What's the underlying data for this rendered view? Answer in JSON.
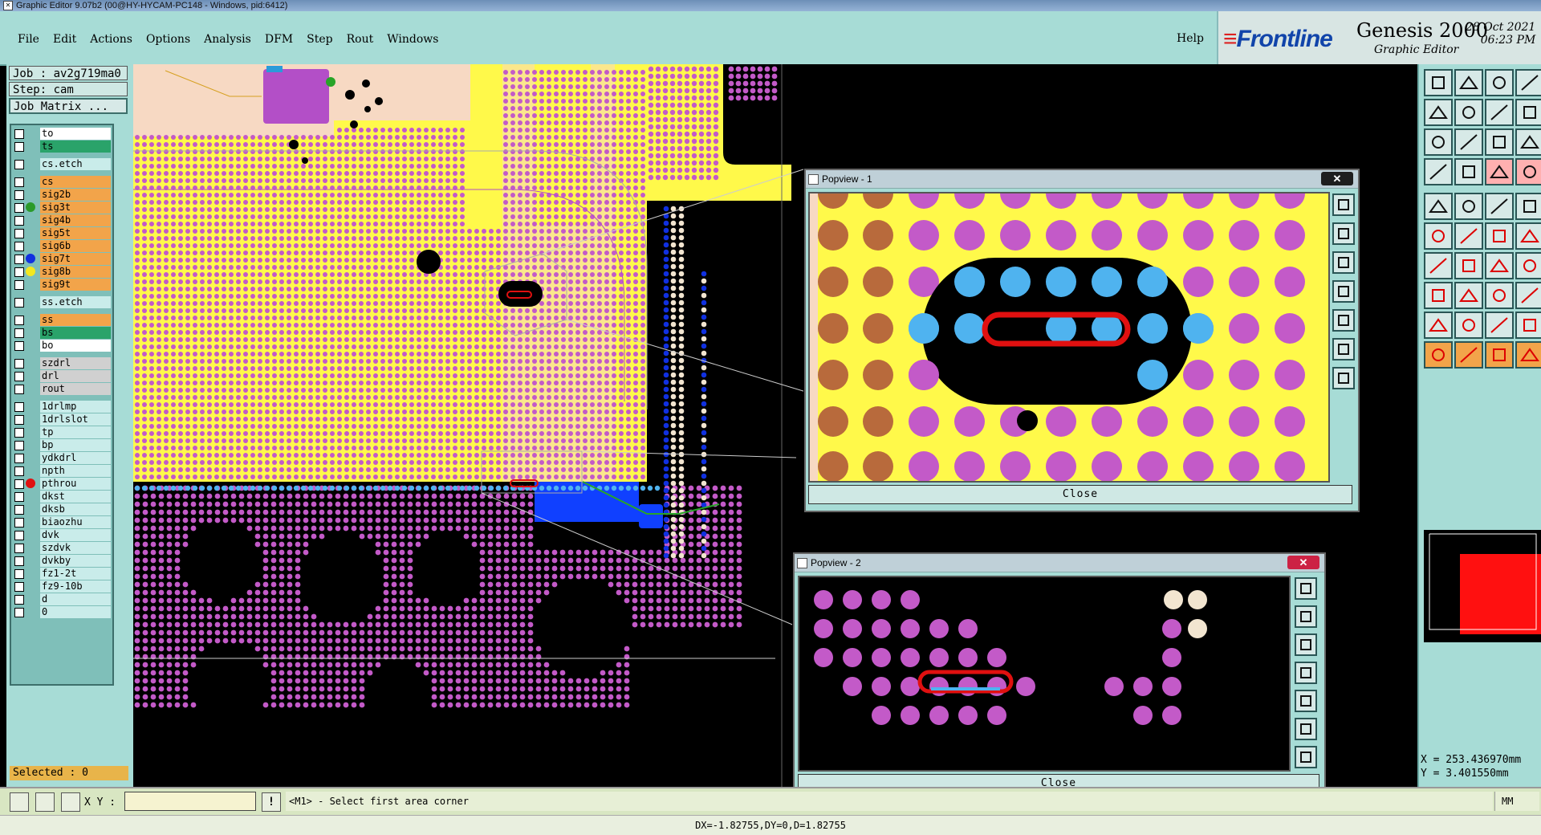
{
  "window": {
    "title": "Graphic Editor 9.07b2 (00@HY-HYCAM-PC148 - Windows, pid:6412)"
  },
  "menu": {
    "items": [
      "File",
      "Edit",
      "Actions",
      "Options",
      "Analysis",
      "DFM",
      "Step",
      "Rout",
      "Windows"
    ],
    "help": "Help"
  },
  "brand": {
    "logo": "Frontline",
    "product": "Genesis 2000",
    "subtitle": "Graphic Editor",
    "date": "28 Oct 2021",
    "time": "06:23 PM"
  },
  "job": {
    "job_label": "Job : av2g719ma0",
    "step_label": "Step: cam",
    "matrix_button": "Job Matrix ..."
  },
  "layers": [
    {
      "name": "to",
      "color": "#ffffff",
      "dot": ""
    },
    {
      "name": "ts",
      "color": "#2aa36a",
      "dot": ""
    },
    {
      "name": "cs.etch",
      "color": "#c9ecea",
      "dot": ""
    },
    {
      "name": "cs",
      "color": "#f2a44a",
      "dot": ""
    },
    {
      "name": "sig2b",
      "color": "#f2a44a",
      "dot": ""
    },
    {
      "name": "sig3t",
      "color": "#f2a44a",
      "dot": "#2a9a2a"
    },
    {
      "name": "sig4b",
      "color": "#f2a44a",
      "dot": ""
    },
    {
      "name": "sig5t",
      "color": "#f2a44a",
      "dot": ""
    },
    {
      "name": "sig6b",
      "color": "#f2a44a",
      "dot": ""
    },
    {
      "name": "sig7t",
      "color": "#f2a44a",
      "dot": "#1030e0"
    },
    {
      "name": "sig8b",
      "color": "#f2a44a",
      "dot": "#f3e81f"
    },
    {
      "name": "sig9t",
      "color": "#f2a44a",
      "dot": ""
    },
    {
      "name": "ss.etch",
      "color": "#c9ecea",
      "dot": ""
    },
    {
      "name": "ss",
      "color": "#f2a44a",
      "dot": ""
    },
    {
      "name": "bs",
      "color": "#2aa36a",
      "dot": ""
    },
    {
      "name": "bo",
      "color": "#ffffff",
      "dot": ""
    },
    {
      "name": "szdrl",
      "color": "#d0d0d0",
      "dot": ""
    },
    {
      "name": "drl",
      "color": "#d0d0d0",
      "dot": ""
    },
    {
      "name": "rout",
      "color": "#d0d0d0",
      "dot": ""
    },
    {
      "name": "1drlmp",
      "color": "#c9ecea",
      "dot": ""
    },
    {
      "name": "1drlslot",
      "color": "#c9ecea",
      "dot": ""
    },
    {
      "name": "tp",
      "color": "#c9ecea",
      "dot": ""
    },
    {
      "name": "bp",
      "color": "#c9ecea",
      "dot": ""
    },
    {
      "name": "ydkdrl",
      "color": "#c9ecea",
      "dot": ""
    },
    {
      "name": "npth",
      "color": "#c9ecea",
      "dot": ""
    },
    {
      "name": "pthrou",
      "color": "#c9ecea",
      "dot": "#e01010"
    },
    {
      "name": "dkst",
      "color": "#c9ecea",
      "dot": ""
    },
    {
      "name": "dksb",
      "color": "#c9ecea",
      "dot": ""
    },
    {
      "name": "biaozhu",
      "color": "#c9ecea",
      "dot": ""
    },
    {
      "name": "dvk",
      "color": "#c9ecea",
      "dot": ""
    },
    {
      "name": "szdvk",
      "color": "#c9ecea",
      "dot": ""
    },
    {
      "name": "dvkby",
      "color": "#c9ecea",
      "dot": ""
    },
    {
      "name": "fz1-2t",
      "color": "#c9ecea",
      "dot": ""
    },
    {
      "name": "fz9-10b",
      "color": "#c9ecea",
      "dot": ""
    },
    {
      "name": "d",
      "color": "#c9ecea",
      "dot": ""
    },
    {
      "name": "0",
      "color": "#c9ecea",
      "dot": ""
    }
  ],
  "selected": "Selected : 0",
  "popview1": {
    "title": "Popview - 1",
    "close_label": "Close"
  },
  "popview2": {
    "title": "Popview - 2",
    "close_label": "Close"
  },
  "coords": {
    "x": "X = 253.436970mm",
    "y": "Y =   3.401550mm"
  },
  "bottom": {
    "xy_label": "X Y :",
    "xy_value": "",
    "prompt": "<M1> - Select first area corner",
    "unit": "MM",
    "bang": "!"
  },
  "status": "DX=-1.82755,DY=0,D=1.82755",
  "colors": {
    "panel": "#a7dcd6",
    "signal_fill": "#fff94a",
    "pad_magenta": "#c35ac8",
    "pad_blue": "#4fb3ef",
    "outline_red": "#e01010",
    "background": "#000000"
  }
}
